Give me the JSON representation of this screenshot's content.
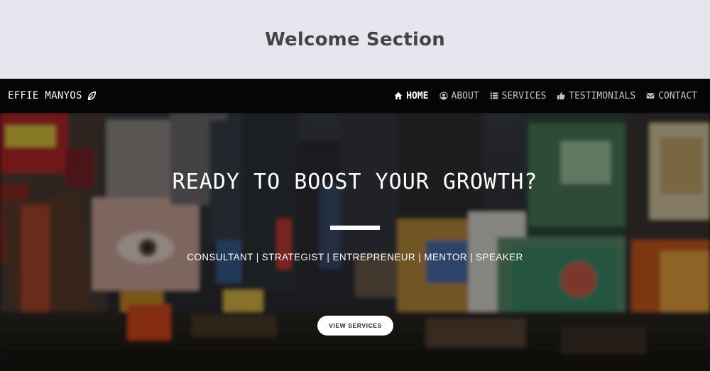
{
  "section": {
    "title": "Welcome Section"
  },
  "navbar": {
    "brand": "EFFIE MANYOS",
    "brand_icon": "leaf-icon",
    "items": [
      {
        "label": "HOME",
        "icon": "home-icon",
        "active": true
      },
      {
        "label": "ABOUT",
        "icon": "user-circle-icon",
        "active": false
      },
      {
        "label": "SERVICES",
        "icon": "list-icon",
        "active": false
      },
      {
        "label": "TESTIMONIALS",
        "icon": "thumbs-up-icon",
        "active": false
      },
      {
        "label": "CONTACT",
        "icon": "envelope-icon",
        "active": false
      }
    ]
  },
  "hero": {
    "title": "READY TO BOOST YOUR GROWTH?",
    "subtitle": "CONSULTANT | STRATEGIST | ENTREPRENEUR | MENTOR | SPEAKER",
    "button_label": "VIEW SERVICES",
    "background": "blurred-city-billboards-image"
  },
  "colors": {
    "page_background": "#e6e7ee",
    "navbar_background": "#050505",
    "accent": "#ffffff",
    "title_text": "#44444a"
  }
}
